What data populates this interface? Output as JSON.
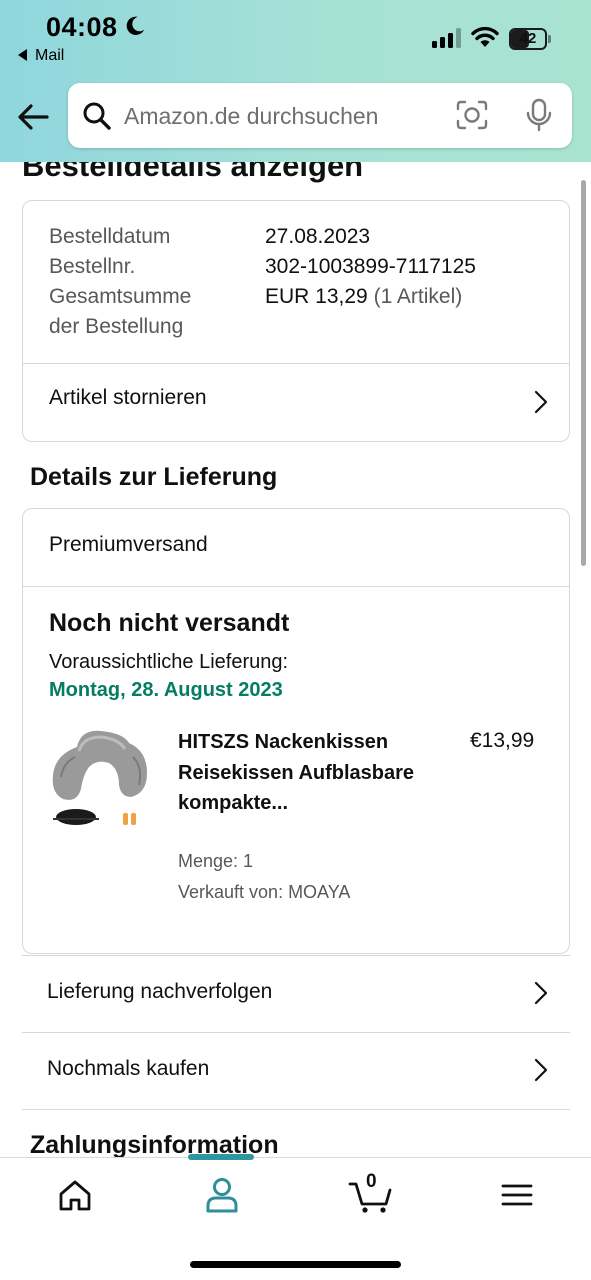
{
  "status_bar": {
    "time": "04:08",
    "back_app": "Mail",
    "battery": "42"
  },
  "search": {
    "placeholder": "Amazon.de durchsuchen"
  },
  "page": {
    "title": "Bestelldetails anzeigen"
  },
  "order_summary": {
    "date_label": "Bestelldatum",
    "date_value": "27.08.2023",
    "number_label": "Bestellnr.",
    "number_value": "302-1003899-7117125",
    "total_label_line1": "Gesamtsumme",
    "total_label_line2": "der Bestellung",
    "total_value": "EUR 13,29",
    "total_items": "(1 Artikel)",
    "cancel_label": "Artikel stornieren"
  },
  "delivery": {
    "section_title": "Details zur Lieferung",
    "shipping_type": "Premiumversand",
    "status": "Noch nicht versandt",
    "eta_label": "Voraussichtliche Lieferung:",
    "eta_date": "Montag, 28. August 2023",
    "product": {
      "title": "HITSZS Nackenkissen Reisekissen Aufblasbare kompakte...",
      "price": "€13,99",
      "quantity": "Menge: 1",
      "seller": "Verkauft von: MOAYA"
    }
  },
  "actions": {
    "track": "Lieferung nachverfolgen",
    "buy_again": "Nochmals kaufen"
  },
  "payment": {
    "section_title": "Zahlungsinformation"
  },
  "bottom_nav": {
    "cart_count": "0"
  },
  "colors": {
    "header_gradient_start": "#8fd6dd",
    "header_gradient_end": "#a9e3d0",
    "delivery_green": "#067d62",
    "nav_accent": "#2f96a0"
  }
}
